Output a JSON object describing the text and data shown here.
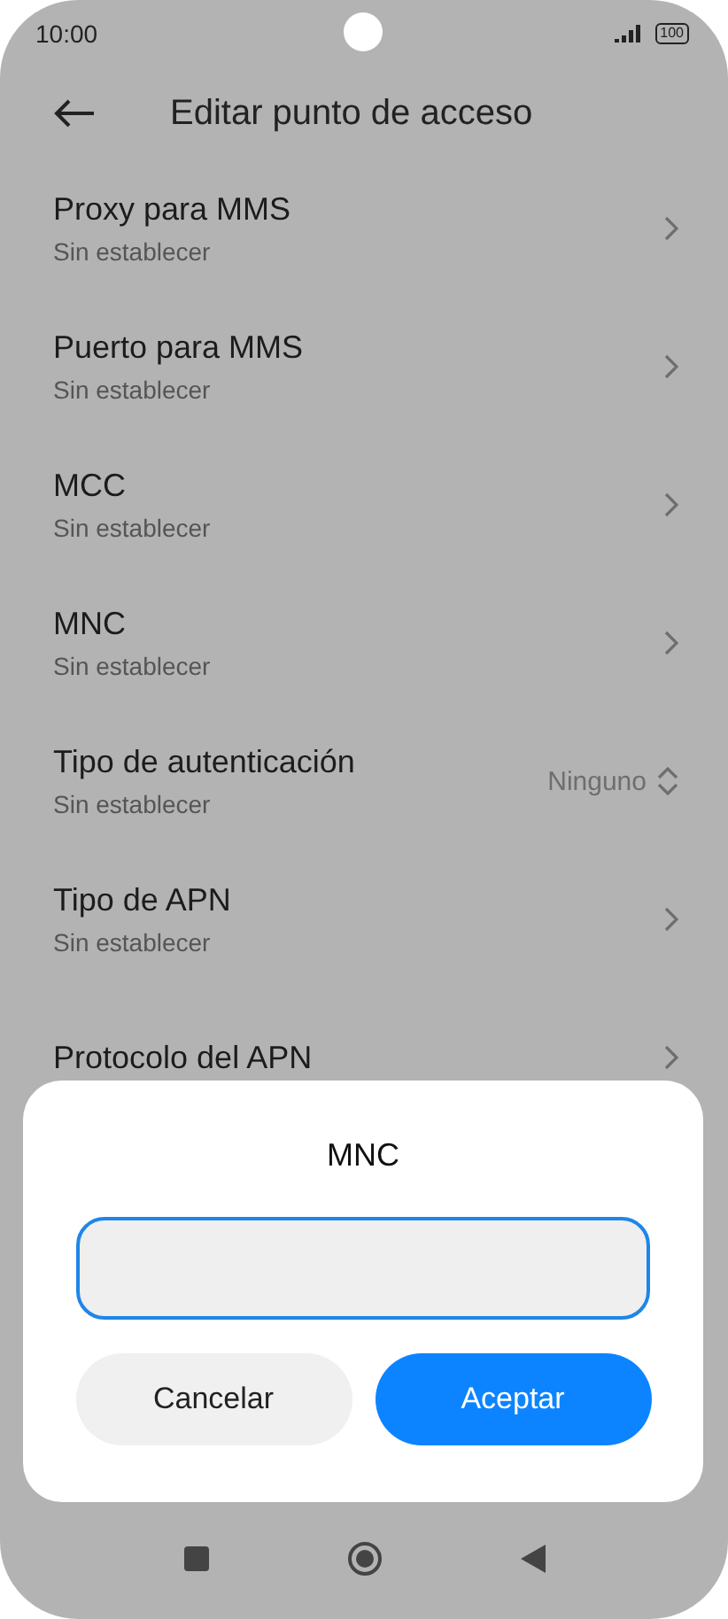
{
  "status_bar": {
    "time": "10:00",
    "battery": "100"
  },
  "header": {
    "title": "Editar punto de acceso"
  },
  "rows": [
    {
      "kind": "link",
      "title": "Proxy para MMS",
      "subtitle": "Sin establecer"
    },
    {
      "kind": "link",
      "title": "Puerto para MMS",
      "subtitle": "Sin establecer"
    },
    {
      "kind": "link",
      "title": "MCC",
      "subtitle": "Sin establecer"
    },
    {
      "kind": "link",
      "title": "MNC",
      "subtitle": "Sin establecer"
    },
    {
      "kind": "select",
      "title": "Tipo de autenticación",
      "subtitle": "Sin establecer",
      "value": "Ninguno"
    },
    {
      "kind": "link",
      "title": "Tipo de APN",
      "subtitle": "Sin establecer"
    },
    {
      "kind": "link",
      "title": "Protocolo del APN"
    }
  ],
  "dialog": {
    "title": "MNC",
    "field": {
      "focused": true
    },
    "buttons": [
      {
        "label": "Cancelar",
        "primary": false
      },
      {
        "label": "Aceptar",
        "primary": true
      }
    ]
  }
}
